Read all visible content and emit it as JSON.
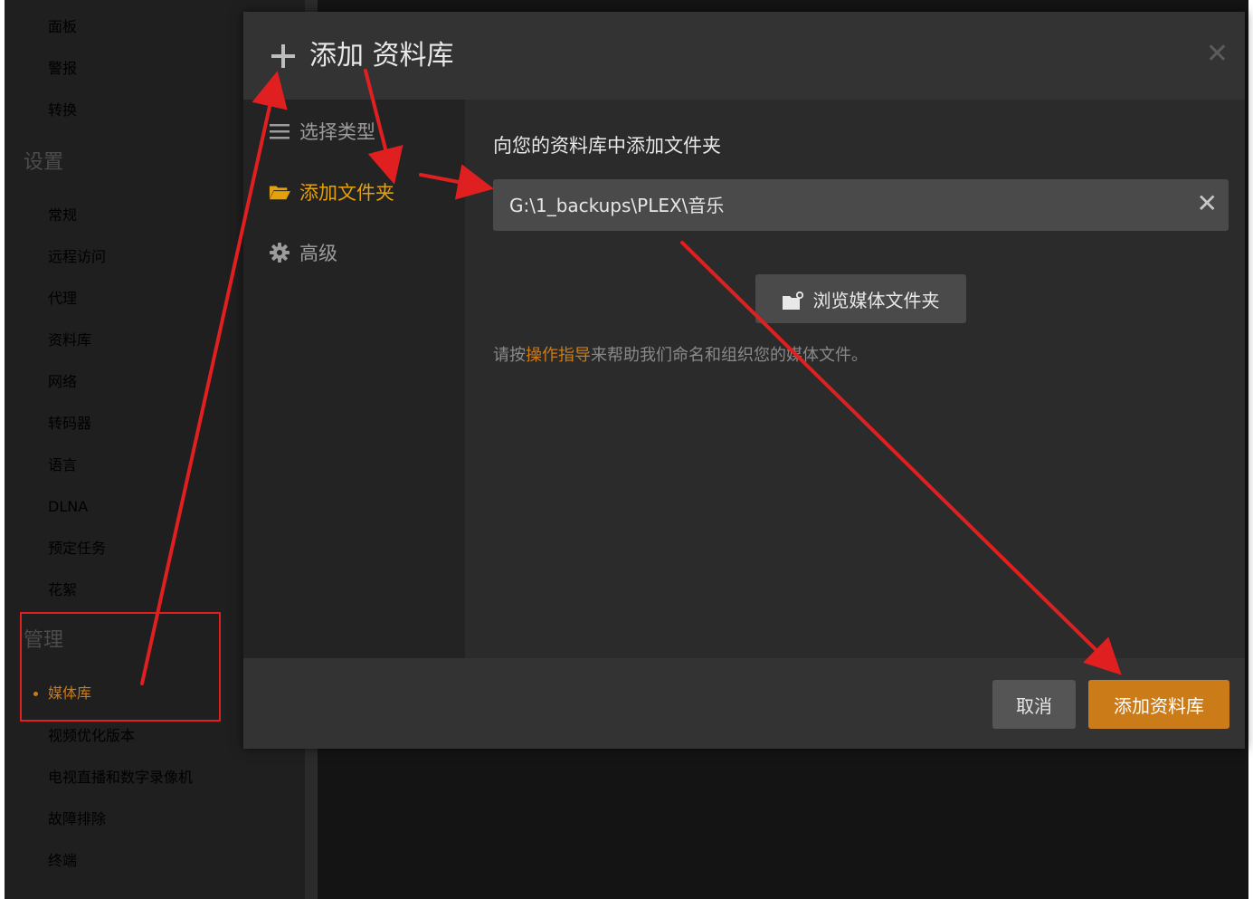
{
  "sidebar": {
    "items_top": [
      "面板",
      "警报",
      "转换"
    ],
    "settings_section": "设置",
    "settings_items": [
      "常规",
      "远程访问",
      "代理",
      "资料库",
      "网络",
      "转码器",
      "语言",
      "DLNA",
      "预定任务",
      "花絮"
    ],
    "manage_section": "管理",
    "manage_items": [
      "媒体库",
      "视频优化版本",
      "电视直播和数字录像机",
      "故障排除",
      "终端"
    ],
    "active_item": "媒体库"
  },
  "modal": {
    "title": "添加 资料库",
    "close_icon": "close-icon",
    "steps": [
      {
        "label": "选择类型",
        "icon": "list-icon"
      },
      {
        "label": "添加文件夹",
        "icon": "folder-open-icon"
      },
      {
        "label": "高级",
        "icon": "gear-icon"
      }
    ],
    "active_step": "添加文件夹",
    "section_title": "向您的资料库中添加文件夹",
    "folder_path": "G:\\1_backups\\PLEX\\音乐",
    "browse_label": "浏览媒体文件夹",
    "hint_prefix": "请按",
    "hint_link": "操作指导",
    "hint_suffix": "来帮助我们命名和组织您的媒体文件。",
    "cancel_label": "取消",
    "add_label": "添加资料库"
  },
  "colors": {
    "accent": "#cc7b19",
    "active_step": "#e5a00d",
    "annotation": "#e02020"
  }
}
